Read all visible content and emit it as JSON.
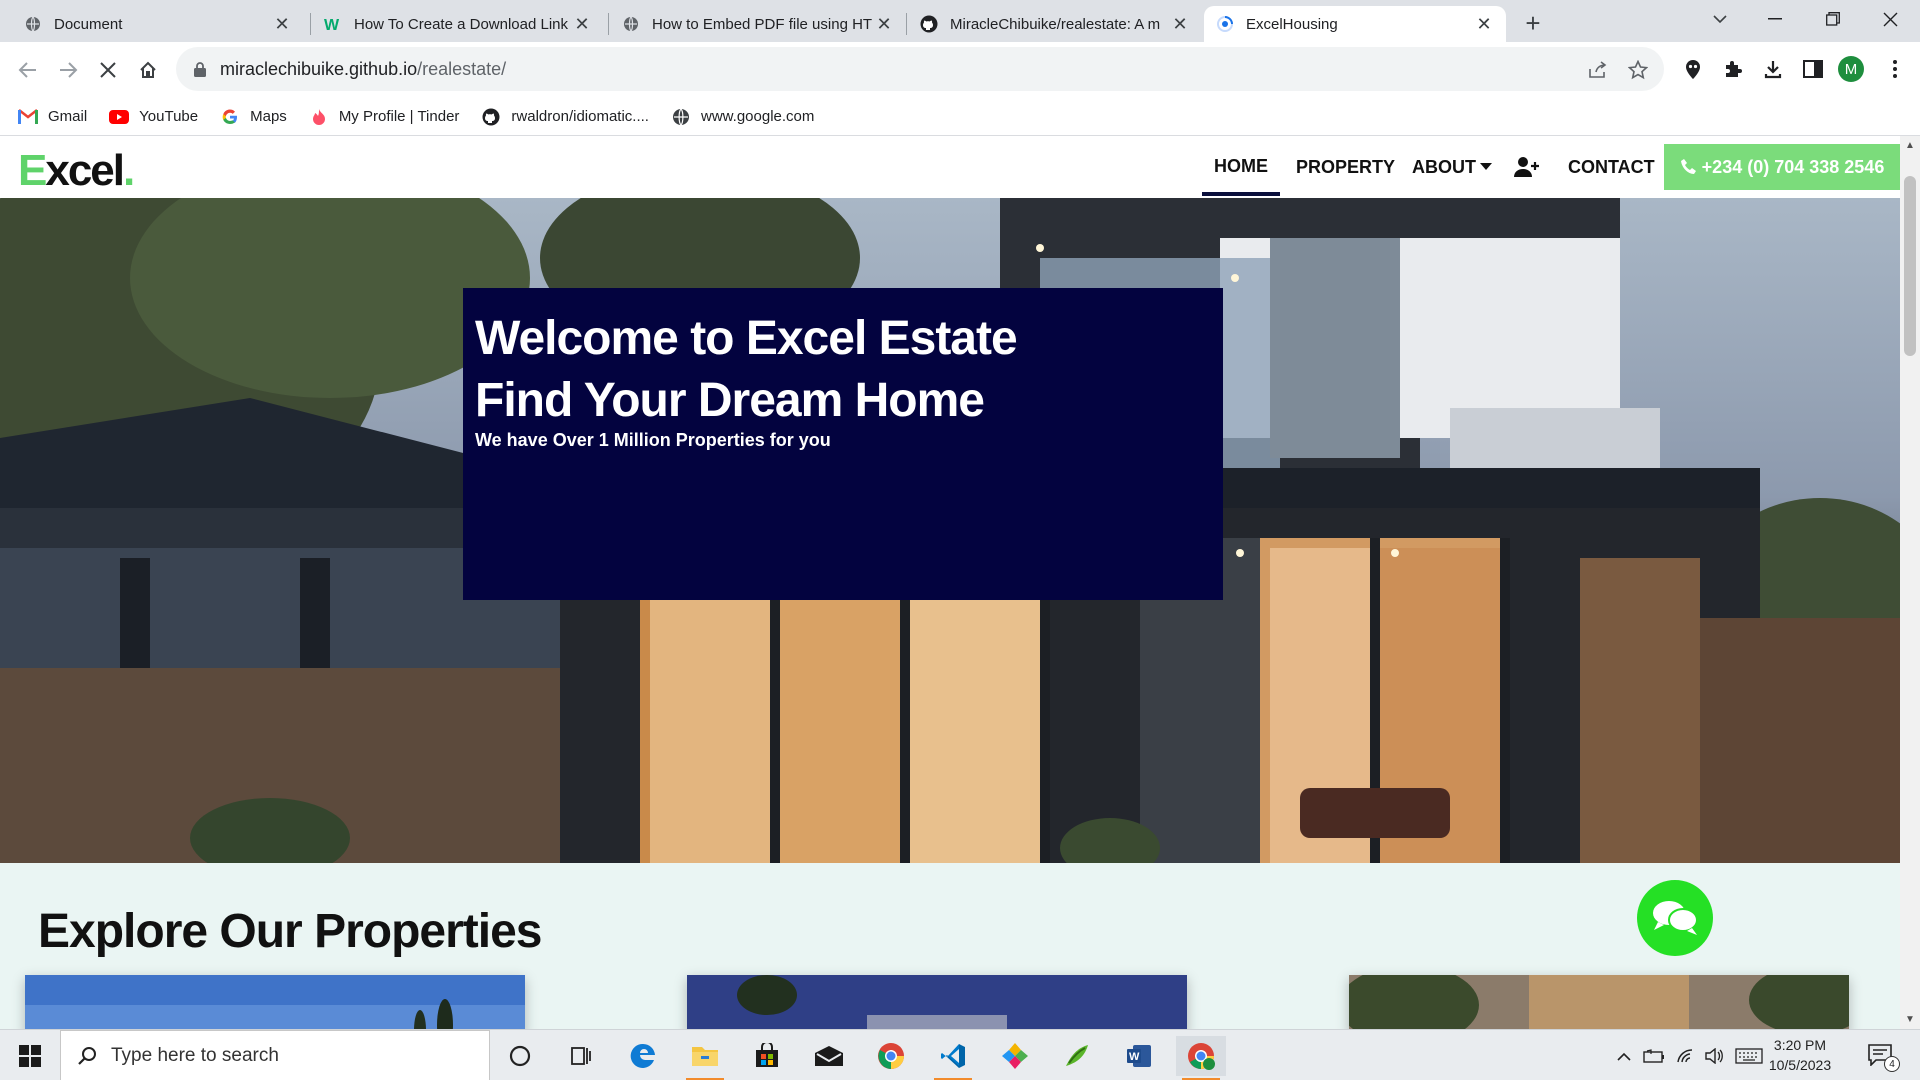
{
  "browser": {
    "tabs": [
      {
        "title": "Document",
        "icon": "globe-icon"
      },
      {
        "title": "How To Create a Download Link",
        "icon": "w3schools-icon"
      },
      {
        "title": "How to Embed PDF file using HT",
        "icon": "globe-icon"
      },
      {
        "title": "MiracleChibuike/realestate: A m",
        "icon": "github-icon"
      },
      {
        "title": "ExcelHousing",
        "icon": "loading-icon",
        "active": true
      }
    ],
    "new_tab_label": "+",
    "url_host": "miraclechibuike.github.io",
    "url_path": "/realestate/",
    "bookmarks": [
      {
        "label": "Gmail",
        "icon": "gmail-icon"
      },
      {
        "label": "YouTube",
        "icon": "youtube-icon"
      },
      {
        "label": "Maps",
        "icon": "google-icon"
      },
      {
        "label": "My Profile | Tinder",
        "icon": "tinder-icon"
      },
      {
        "label": "rwaldron/idiomatic....",
        "icon": "github-icon"
      },
      {
        "label": "www.google.com",
        "icon": "globe-icon"
      }
    ],
    "profile_initial": "M"
  },
  "site": {
    "logo_first": "E",
    "logo_rest": "xcel",
    "logo_dot": ".",
    "nav": {
      "home": "HOME",
      "property": "PROPERTY",
      "about": "ABOUT",
      "contact": "CONTACT"
    },
    "phone": "+234 (0) 704 338 2546",
    "hero": {
      "title_line1": "Welcome to Excel Estate",
      "title_line2": "Find Your Dream Home",
      "subtitle": "We have Over 1 Million Properties for you"
    },
    "section_title": "Explore Our Properties"
  },
  "taskbar": {
    "search_placeholder": "Type here to search",
    "time": "3:20 PM",
    "date": "10/5/2023",
    "notification_count": "4"
  },
  "colors": {
    "accent_green": "#7bdc7b",
    "hero_box": "#03033f",
    "chat_green": "#25e025"
  }
}
